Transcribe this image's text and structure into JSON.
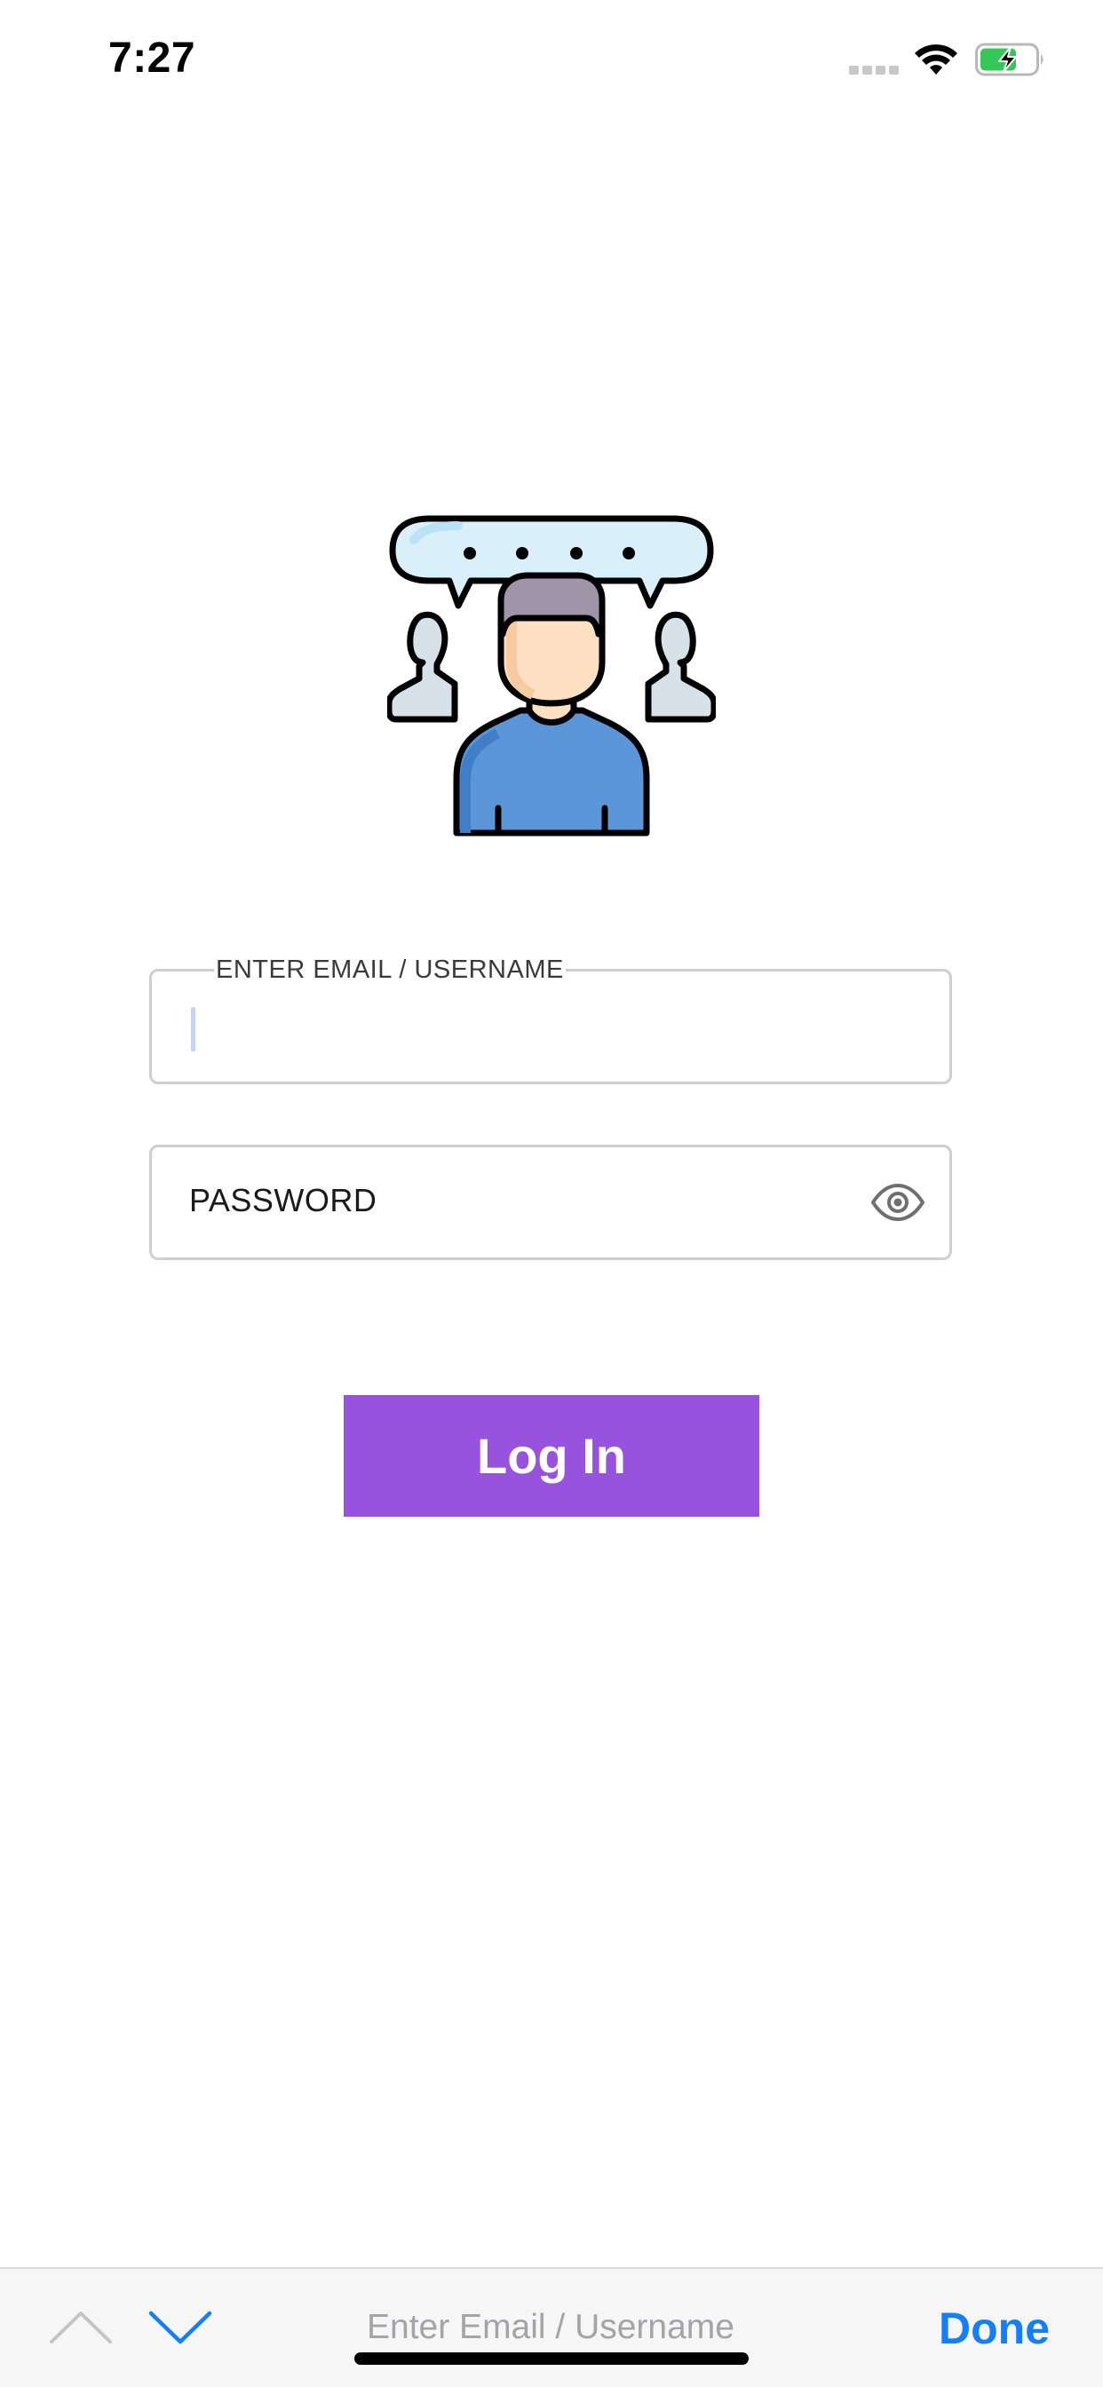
{
  "status_bar": {
    "time": "7:27",
    "icons": [
      "signal-icon",
      "wifi-icon",
      "battery-charging-icon"
    ]
  },
  "illustration": {
    "icon": "user-group-chat-icon",
    "colors": {
      "bubble": "#d9f0fb",
      "hair": "#9f94a8",
      "face": "#fde0c2",
      "shirt": "#5b96d9",
      "background_person": "#d6e1ea",
      "outline": "#000000"
    }
  },
  "login_form": {
    "email_label": "ENTER EMAIL / USERNAME",
    "email_value": "",
    "password_label": "PASSWORD",
    "password_value": "",
    "show_password_icon": "eye-icon"
  },
  "login_button": {
    "label": "Log In",
    "color": "#9753dd"
  },
  "keyboard_accessory": {
    "previous_icon": "chevron-up-icon",
    "next_icon": "chevron-down-icon",
    "field_hint": "Enter Email / Username",
    "done_label": "Done",
    "accent_color": "#147efb"
  }
}
